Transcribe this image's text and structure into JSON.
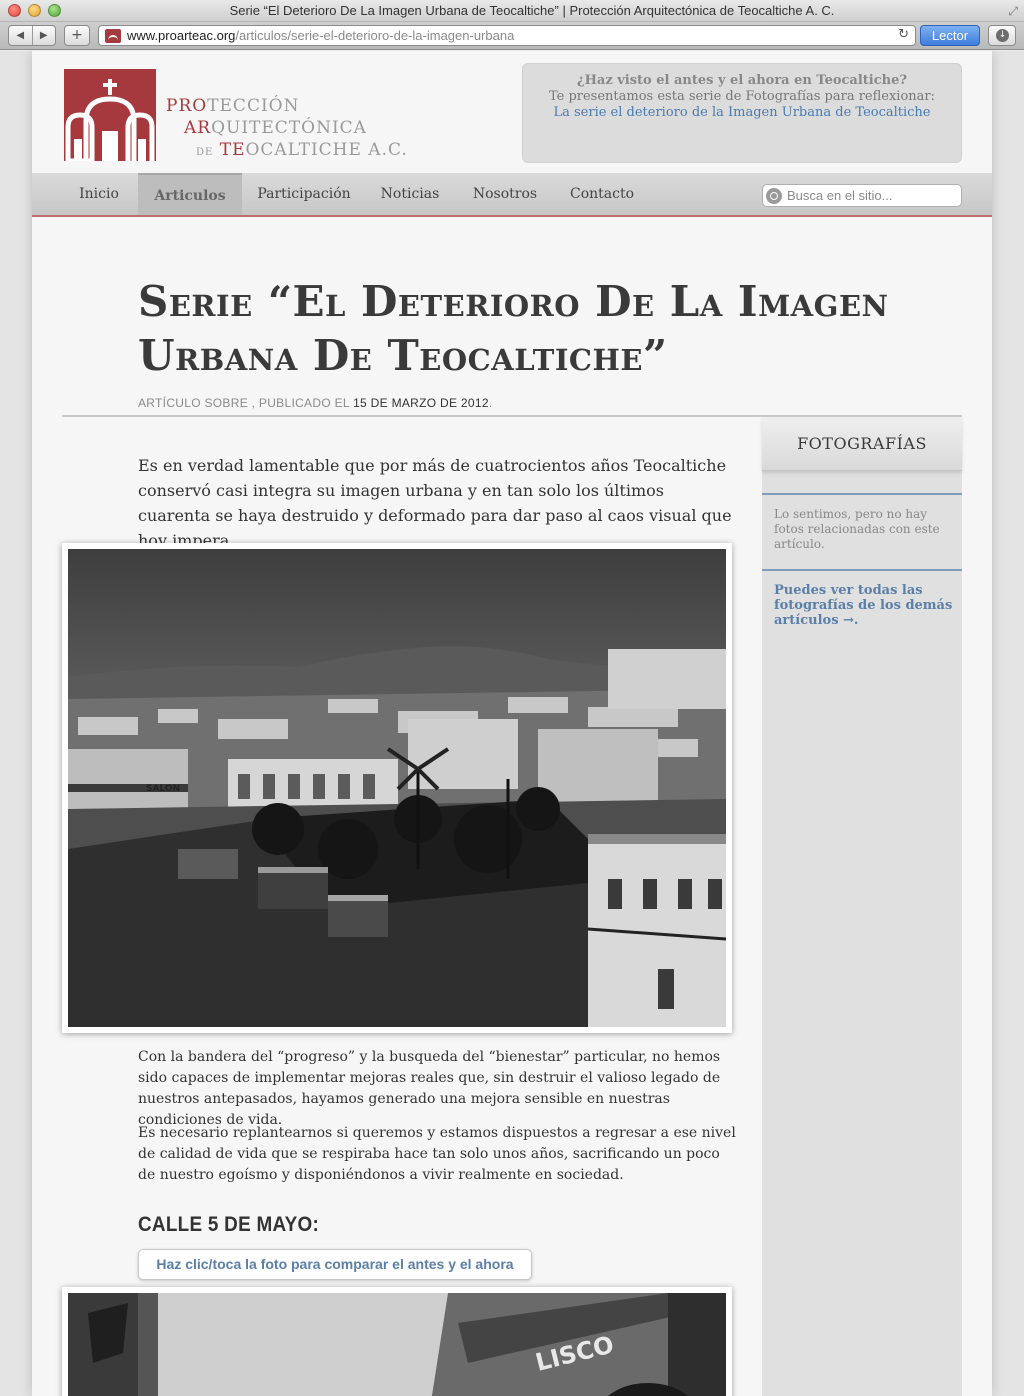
{
  "browser": {
    "window_title": "Serie “El Deterioro De La Imagen Urbana de Teocaltiche” | Protección Arquitectónica de Teocaltiche A. C.",
    "url_host": "www.proarteac.org",
    "url_path": "/articulos/serie-el-deterioro-de-la-imagen-urbana",
    "back_glyph": "◀",
    "forward_glyph": "▶",
    "add_glyph": "+",
    "reload_glyph": "↻",
    "reader_label": "Lector",
    "download_glyph": "↓",
    "fullscreen_glyph": "⤢"
  },
  "logo": {
    "line1_red": "PRO",
    "line1_gray": "TECCIÓN",
    "line2_red": "AR",
    "line2_gray": "QUITECTÓNICA",
    "line3_small": "DE",
    "line3_red": "TE",
    "line3_gray": "OCALTICHE A.C."
  },
  "promo": {
    "title": "¿Haz visto el antes y el ahora en Teocaltiche?",
    "text": "Te presentamos esta serie de Fotografías para reflexionar:",
    "link": "La serie el deterioro de la Imagen Urbana de Teocaltiche"
  },
  "nav": {
    "items": [
      "Inicio",
      "Articulos",
      "Participación",
      "Noticias",
      "Nosotros",
      "Contacto"
    ],
    "active": "Articulos",
    "search_placeholder": "Busca en el sitio..."
  },
  "post": {
    "title": "Serie “El Deterioro De La Imagen Urbana De Teocaltiche”",
    "meta_prefix": "ARTÍCULO SOBRE , PUBLICADO EL",
    "meta_date": "15 DE MARZO DE 2012",
    "meta_suffix": ".",
    "lead": "Es en verdad lamentable que por más de cuatrocientos años Teocaltiche conservó casi integra su imagen urbana y en tan solo los últimos cuarenta se haya destruido y deformado para dar paso al caos visual que hoy impera.",
    "photo1_sign": "SALON",
    "p1": "Con la bandera del “progreso” y la busqueda del “bienestar” particular, no hemos sido capaces de implementar mejoras reales que, sin destruir el valioso legado de nuestros antepasados, hayamos generado una mejora sensible en nuestras condiciones de vida.",
    "p2": "Es necesario replantearnos si queremos y estamos dispuestos a regresar a ese nivel de calidad de vida que se respiraba hace tan solo unos años, sacrificando un poco de nuestro egoísmo y disponiéndonos a vivir realmente en sociedad.",
    "section_heading": "CALLE 5 DE MAYO:",
    "compare_button": "Haz clic/toca la foto para comparar el antes y el ahora",
    "photo2_sign": "LISCO"
  },
  "sidebar": {
    "heading": "FOTOGRAFÍAS",
    "note": "Lo sentimos, pero no hay fotos relacionadas con este artículo.",
    "link": "Puedes ver todas las fotografías de los demás artículos →."
  },
  "colors": {
    "brand_red": "#a5393e",
    "link_blue": "#5a7fa8",
    "reader_blue": "#3c7ddc"
  }
}
